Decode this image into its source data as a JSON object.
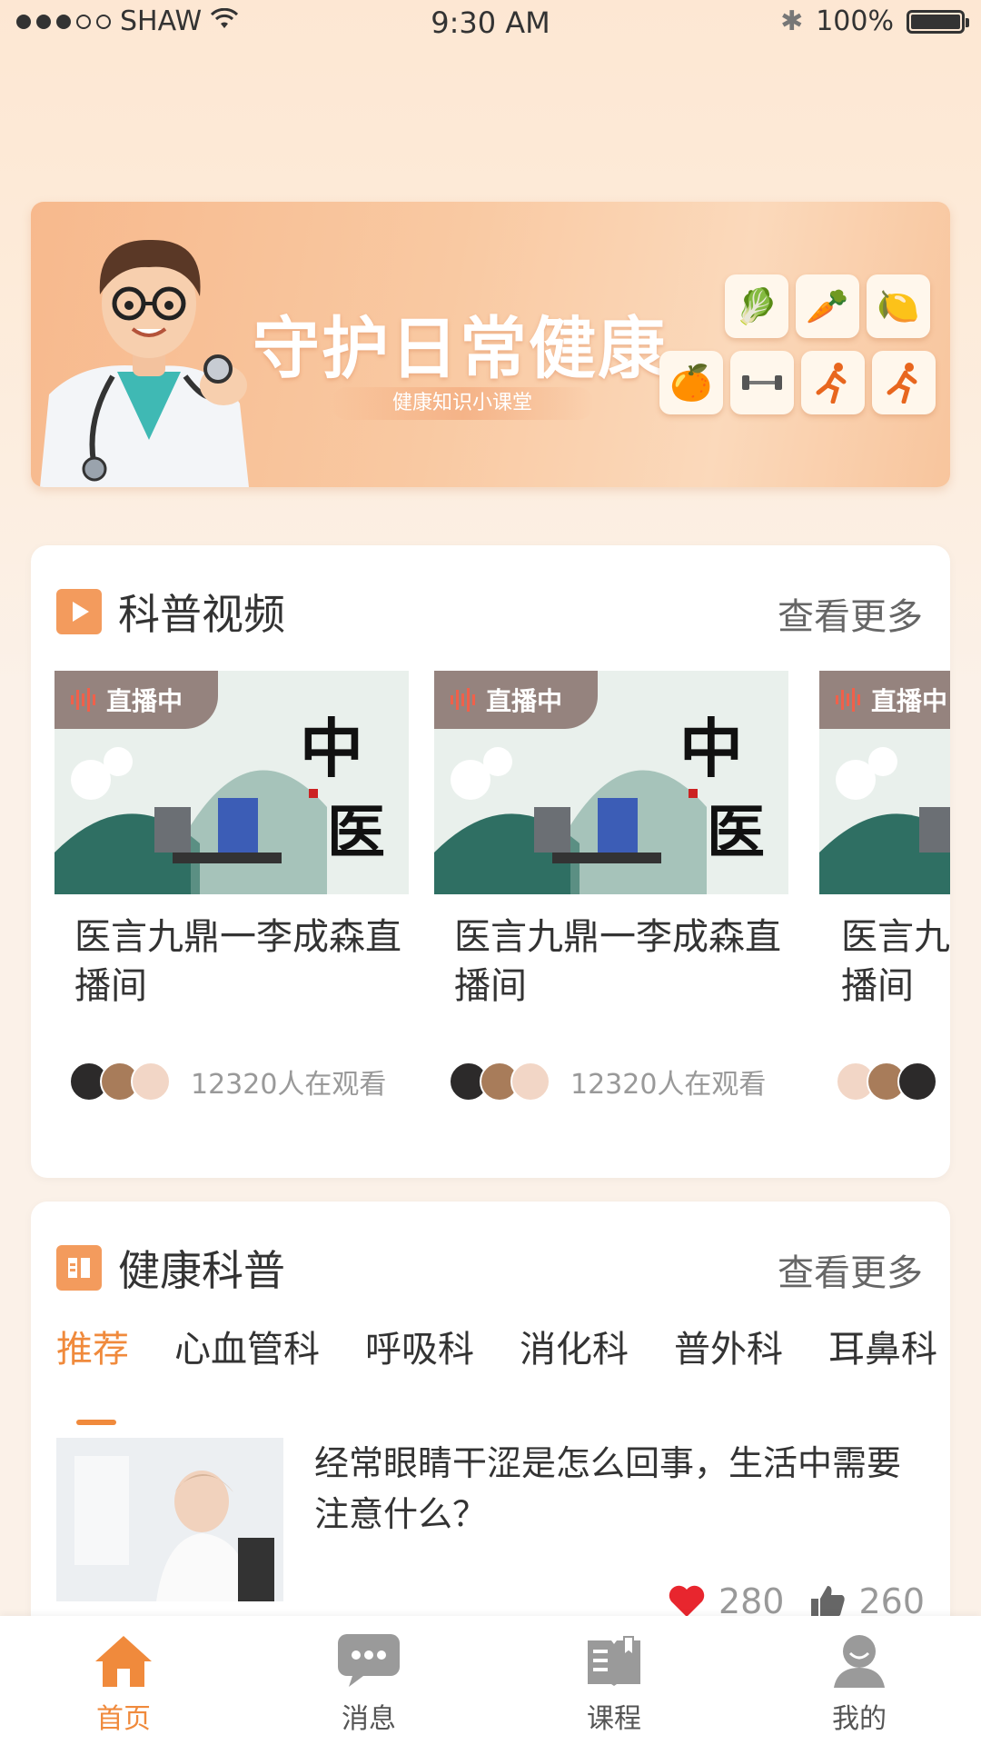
{
  "status_bar": {
    "carrier": "SHAW",
    "time": "9:30 AM",
    "battery": "100%"
  },
  "banner": {
    "title": "守护日常健康",
    "subtitle": "健康知识小课堂"
  },
  "video_section": {
    "title": "科普视频",
    "more_label": "查看更多",
    "videos": [
      {
        "tag": "直播中",
        "title": "医言九鼎一李成森直播间",
        "viewers": "12320人在观看"
      },
      {
        "tag": "直播中",
        "title": "医言九鼎一李成森直播间",
        "viewers": "12320人在观看"
      },
      {
        "tag": "直播中",
        "title": "医言九鼎一李成森直播间",
        "viewers": ""
      }
    ]
  },
  "health_section": {
    "title": "健康科普",
    "more_label": "查看更多",
    "tabs": [
      "推荐",
      "心血管科",
      "呼吸科",
      "消化科",
      "普外科",
      "耳鼻科"
    ],
    "active_tab": 0,
    "articles": [
      {
        "title": "经常眼睛干涩是怎么回事，生活中需要注意什么？",
        "favorites": "280",
        "likes": "260"
      }
    ]
  },
  "tab_bar": {
    "items": [
      {
        "label": "首页",
        "icon": "home-icon",
        "active": true
      },
      {
        "label": "消息",
        "icon": "message-icon",
        "active": false
      },
      {
        "label": "课程",
        "icon": "book-icon",
        "active": false
      },
      {
        "label": "我的",
        "icon": "profile-icon",
        "active": false
      }
    ]
  },
  "colors": {
    "accent": "#f08a3c",
    "live_wave": "#f0604a",
    "heart": "#e8262e"
  }
}
